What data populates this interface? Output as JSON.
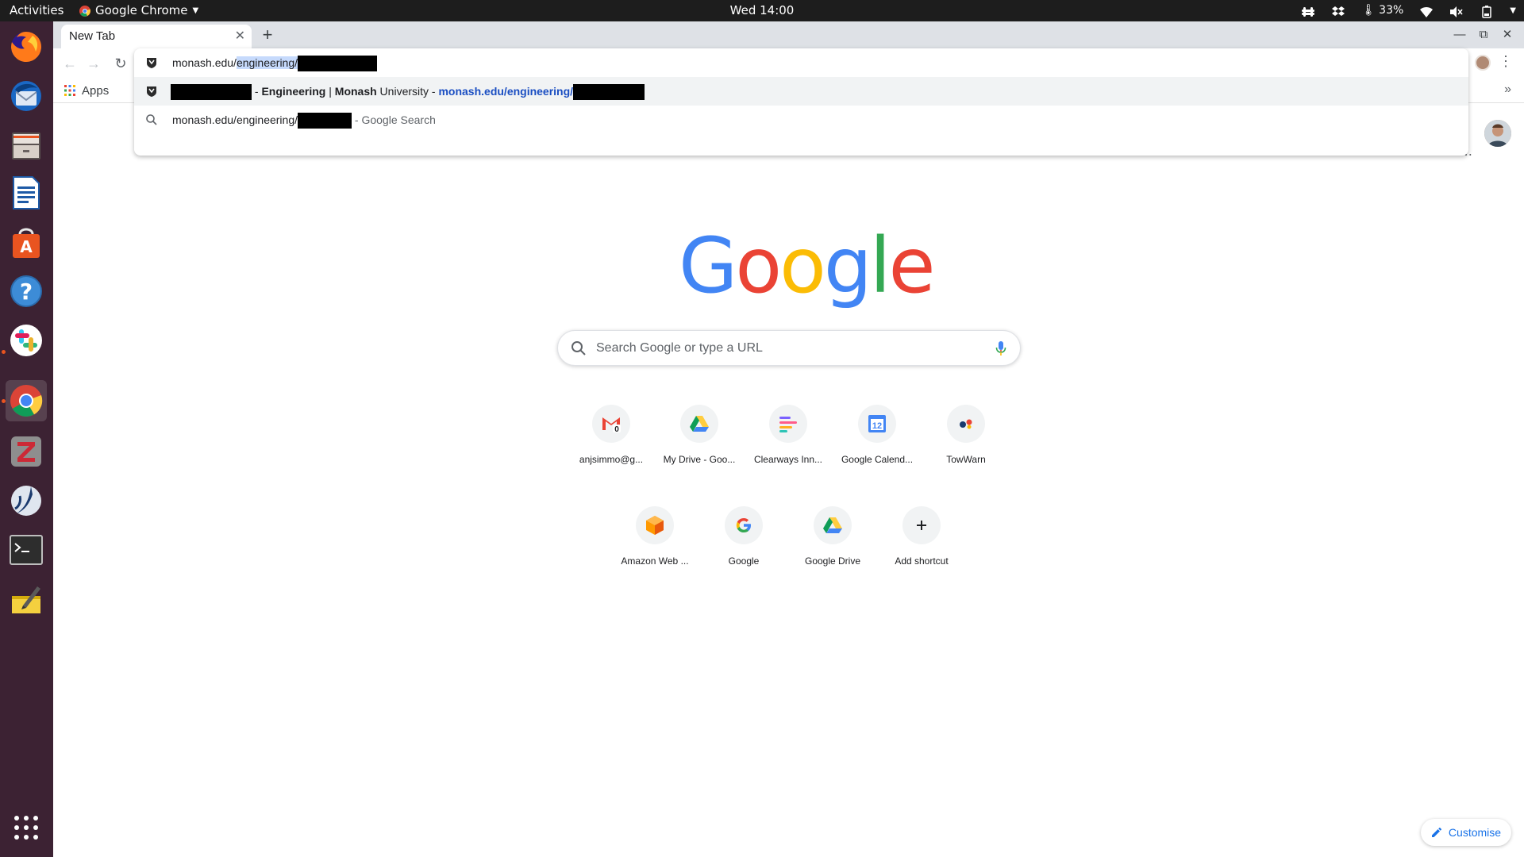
{
  "topbar": {
    "activities": "Activities",
    "app_name": "Google Chrome",
    "clock": "Wed 14:00",
    "battery": "33%"
  },
  "dock": {
    "items": [
      "firefox",
      "thunderbird",
      "files",
      "libreoffice-writer",
      "software-center",
      "help",
      "slack",
      "chrome",
      "zotero",
      "jabref",
      "terminal",
      "text-editor"
    ]
  },
  "tab": {
    "title": "New Tab"
  },
  "bookmarks": {
    "apps_label": "Apps"
  },
  "omnibox": {
    "input_prefix": "monash.edu/",
    "input_highlight": "engineering/",
    "suggestion_1": {
      "title_sep": " - ",
      "title_bold_1": "Engineering",
      "title_mid": " | ",
      "title_bold_2": "Monash",
      "title_tail": " University - ",
      "url": "monash.edu/engineering/"
    },
    "suggestion_2": {
      "query": "monash.edu/engineering/",
      "suffix": " - Google Search"
    }
  },
  "search": {
    "placeholder": "Search Google or type a URL"
  },
  "shortcuts": [
    {
      "label": "anjsimmo@g...",
      "icon": "gmail-icon"
    },
    {
      "label": "My Drive - Goo...",
      "icon": "drive-icon"
    },
    {
      "label": "Clearways Inn...",
      "icon": "clearways-icon"
    },
    {
      "label": "Google Calend...",
      "icon": "calendar-icon",
      "badge": "12"
    },
    {
      "label": "TowWarn",
      "icon": "towwarn-icon"
    },
    {
      "label": "Amazon Web ...",
      "icon": "aws-icon"
    },
    {
      "label": "Google",
      "icon": "google-icon"
    },
    {
      "label": "Google Drive",
      "icon": "drive-icon"
    },
    {
      "label": "Add shortcut",
      "icon": "plus-icon"
    }
  ],
  "customise": {
    "label": "Customise"
  },
  "colors": {
    "google_blue": "#4285f4",
    "google_red": "#ea4335",
    "google_yellow": "#fbbc05",
    "google_green": "#34a853",
    "dock_bg": "#3c2233",
    "topbar_bg": "#1d1d1d"
  }
}
